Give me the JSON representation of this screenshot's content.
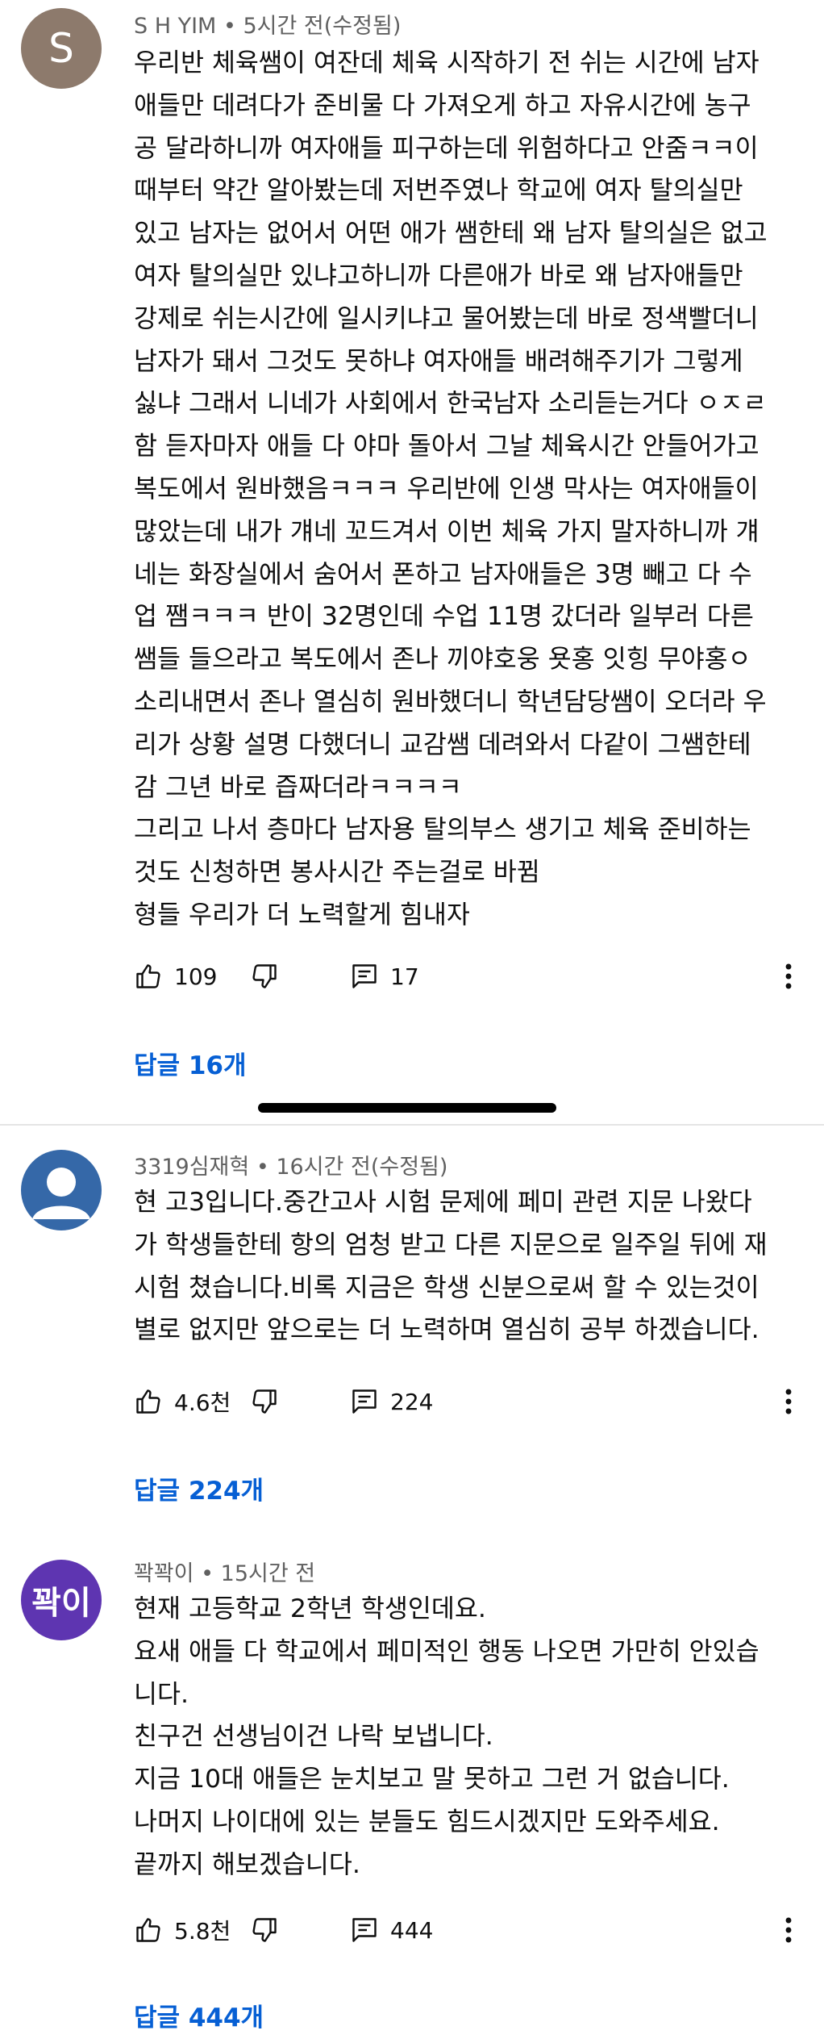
{
  "comments": [
    {
      "author": "S H YIM",
      "time": "5시간 전(수정됨)",
      "avatar_text": "S",
      "avatar_color": "#8d7a6c",
      "lines": [
        "우리반 체육쌤이 여잔데 체육 시작하기 전 쉬는 시간에 남자",
        "애들만 데려다가  준비물 다 가져오게 하고 자유시간에 농구",
        "공 달라하니까 여자애들 피구하는데 위험하다고 안줌ㅋㅋ이",
        "때부터 약간 알아봤는데 저번주였나 학교에 여자 탈의실만",
        "있고 남자는 없어서 어떤 애가 쌤한테 왜 남자 탈의실은 없고",
        "여자 탈의실만 있냐고하니까 다른애가 바로 왜 남자애들만",
        "강제로 쉬는시간에 일시키냐고 물어봤는데 바로 정색빨더니",
        "남자가 돼서 그것도 못하냐 여자애들 배려해주기가 그렇게",
        "싫냐 그래서 니네가 사회에서 한국남자 소리듣는거다 ㅇㅈㄹ",
        "함 듣자마자 애들 다 야마 돌아서 그날 체육시간 안들어가고",
        "복도에서 원바했음ㅋㅋㅋ 우리반에 인생 막사는 여자애들이",
        "많았는데 내가 걔네 꼬드겨서 이번 체육 가지 말자하니까 걔",
        "네는 화장실에서 숨어서 폰하고 남자애들은 3명 빼고 다 수",
        "업 쨈ㅋㅋㅋ 반이 32명인데 수업 11명 갔더라 일부러 다른",
        "쌤들 들으라고 복도에서 존나 끼야호웅 욧홍 잇힝 무야홍ㅇ",
        "소리내면서 존나 열심히 원바했더니 학년담당쌤이 오더라 우",
        "리가 상황 설명 다했더니 교감쌤 데려와서 다같이 그쌤한테",
        "감 그년 바로 즙짜더라ㅋㅋㅋㅋ",
        "그리고 나서 층마다 남자용 탈의부스 생기고 체육 준비하는",
        "것도 신청하면 봉사시간 주는걸로 바뀜",
        "형들 우리가 더 노력할게 힘내자"
      ],
      "likes": "109",
      "reply_count": "17",
      "replies_link": "답글 16개"
    },
    {
      "author": "3319심재혁",
      "time": "16시간 전(수정됨)",
      "avatar_text": "",
      "avatar_color": "#3568a8",
      "lines": [
        "현 고3입니다.중간고사 시험 문제에 페미 관련 지문 나왔다",
        "가 학생들한테 항의 엄청 받고 다른 지문으로 일주일 뒤에 재",
        "시험 쳤습니다.비록 지금은 학생 신분으로써 할 수 있는것이",
        "별로 없지만 앞으로는 더 노력하며 열심히 공부 하겠습니다."
      ],
      "likes": "4.6천",
      "reply_count": "224",
      "replies_link": "답글 224개"
    },
    {
      "author": "꽉꽉이",
      "time": "15시간 전",
      "avatar_text": "꽉이",
      "avatar_color": "#5e35b1",
      "lines": [
        "현재 고등학교 2학년 학생인데요.",
        "요새 애들 다 학교에서 페미적인 행동 나오면 가만히 안있습",
        "니다.",
        "친구건 선생님이건 나락 보냅니다.",
        "지금 10대 애들은 눈치보고 말 못하고 그런 거 없습니다.",
        "나머지 나이대에 있는 분들도 힘드시겠지만 도와주세요.",
        "끝까지 해보겠습니다."
      ],
      "likes": "5.8천",
      "reply_count": "444",
      "replies_link": "답글 444개"
    }
  ],
  "meta_separator": "•",
  "icons": {
    "like": "thumbs-up-icon",
    "dislike": "thumbs-down-icon",
    "reply": "comment-icon",
    "more": "more-vertical-icon",
    "default_avatar": "person-icon"
  },
  "colors": {
    "link": "#065fd4",
    "meta": "#606060",
    "text": "#0f0f0f"
  }
}
